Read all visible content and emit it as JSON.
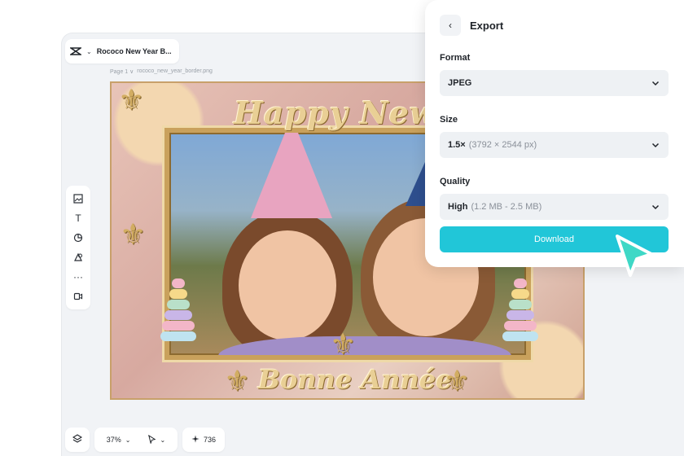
{
  "doc": {
    "title": "Rococo New Year B...",
    "page_label": "Page 1 ∨",
    "file_name": "rococo_new_year_border.png"
  },
  "canvas": {
    "top_text": "Happy New Ye",
    "bottom_text": "Bonne Année"
  },
  "tools": {
    "icons": [
      "image-add-icon",
      "text-icon",
      "shapes-icon",
      "elements-icon",
      "more-icon",
      "media-icon"
    ],
    "text_tool_label": "T",
    "more_label": "···"
  },
  "bottom_bar": {
    "zoom": "37%",
    "count": "736"
  },
  "export": {
    "title": "Export",
    "format_label": "Format",
    "format_value": "JPEG",
    "size_label": "Size",
    "size_value": "1.5×",
    "size_detail": "(3792 × 2544 px)",
    "quality_label": "Quality",
    "quality_value": "High",
    "quality_detail": "(1.2 MB - 2.5 MB)",
    "download_label": "Download"
  },
  "colors": {
    "accent": "#21c6d8",
    "cursor": "#3ed8c6"
  }
}
